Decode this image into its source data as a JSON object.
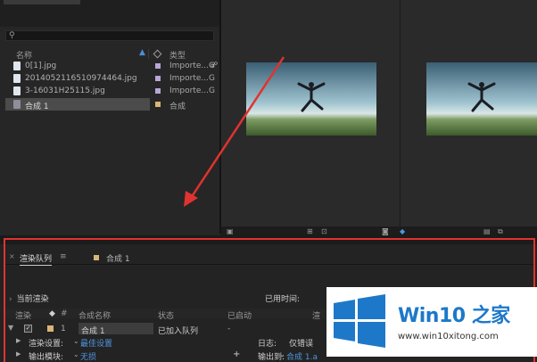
{
  "project_panel": {
    "search_icon": "search-icon",
    "columns": {
      "name": "名称",
      "type": "类型"
    },
    "items": [
      {
        "name": "0[1].jpg",
        "type": "Importe...G",
        "label_color": "#b9a6d9",
        "icon": "image-file-icon"
      },
      {
        "name": "2014052116510974464.jpg",
        "type": "Importe...G",
        "label_color": "#b9a6d9",
        "icon": "image-file-icon"
      },
      {
        "name": "3-16031H25115.jpg",
        "type": "Importe...G",
        "label_color": "#b9a6d9",
        "icon": "image-file-icon"
      },
      {
        "name": "合成 1",
        "type": "合成",
        "label_color": "#d9b47a",
        "icon": "composition-icon",
        "selected": true
      }
    ]
  },
  "render_queue": {
    "tabs": [
      {
        "label": "渲染队列",
        "active": true
      },
      {
        "label": "合成 1",
        "active": false
      }
    ],
    "menu_icon": "hamburger-menu-icon",
    "current_render_label": "当前渲染",
    "elapsed_label": "已用时间:",
    "columns": [
      "渲染",
      "#",
      "合成名称",
      "状态",
      "已启动",
      "渲"
    ],
    "rows": [
      {
        "number": "1",
        "comp_name": "合成 1",
        "status": "已加入队列",
        "started": "-",
        "label_color": "#d9b47a",
        "checked": true
      }
    ],
    "settings": [
      {
        "label": "渲染设置:",
        "value": "最佳设置",
        "right_label": "日志:",
        "right_value": "仅错误"
      },
      {
        "label": "输出模块:",
        "value": "无损",
        "right_label": "输出到:",
        "right_value": "合成 1.a"
      }
    ]
  },
  "watermark": {
    "brand": "Win10 之家",
    "url": "www.win10xitong.com"
  },
  "colors": {
    "accent_blue": "#4f95e0",
    "annotation_red": "#e0332f"
  }
}
